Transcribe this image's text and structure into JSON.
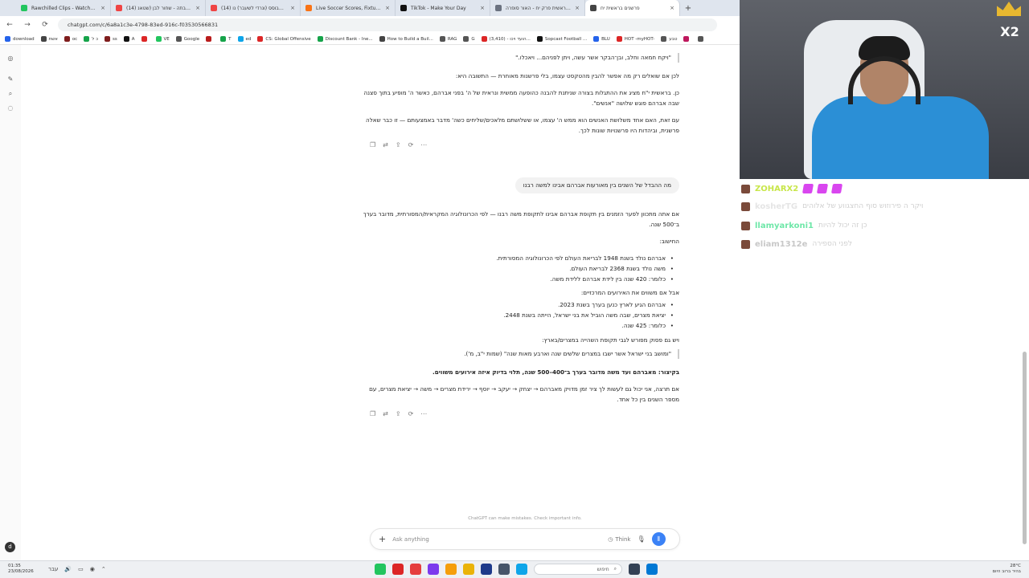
{
  "browser": {
    "tabs": [
      {
        "title": "Rawchilled Clips - Watch Live c...",
        "color": "#22c55e"
      },
      {
        "title": "(14) יאנג טובתה - שחור לבן (שטאנ",
        "color": "#ef4444"
      },
      {
        "title": "(14) שלוםמבוסס (ונרדי לשעבר) נו",
        "color": "#ef4444"
      },
      {
        "title": "Live Soccer Scores, Fixtures, Re...",
        "color": "#f97316"
      },
      {
        "title": "TikTok - Make Your Day",
        "color": "#111111"
      },
      {
        "title": "בראשית פרק יח - האור סופרה...",
        "color": "#6b7280"
      },
      {
        "title": "פרשנים בראשית יח",
        "color": "#444444",
        "active": true
      }
    ],
    "new_tab": "+",
    "close_glyph": "×",
    "url": "chatgpt.com/c/6a8a1c3e-4798-83ed-916c-f03530566831",
    "nav": {
      "back": "←",
      "forward": "→",
      "reload": "⟳",
      "info": "⚙"
    },
    "bookmarks": [
      {
        "label": "download",
        "color": "#2563eb"
      },
      {
        "label": "אשת",
        "color": "#444444"
      },
      {
        "label": "oc",
        "color": "#7f1d1d"
      },
      {
        "label": "כ ל",
        "color": "#16a34a"
      },
      {
        "label": "ss",
        "color": "#7f1d1d"
      },
      {
        "label": "A",
        "color": "#111111"
      },
      {
        "label": "",
        "color": "#dc2626"
      },
      {
        "label": "VE",
        "color": "#22c55e"
      },
      {
        "label": "Google",
        "color": "#555555"
      },
      {
        "label": "",
        "color": "#b91c1c"
      },
      {
        "label": "T",
        "color": "#16a34a"
      },
      {
        "label": "ed",
        "color": "#0ea5e9"
      },
      {
        "label": "CS: Global Offensive",
        "color": "#dc2626"
      },
      {
        "label": "Discount Bank - Ine...",
        "color": "#16a34a"
      },
      {
        "label": "How to Build a Buil...",
        "color": "#444444"
      },
      {
        "label": "RAG",
        "color": "#555555"
      },
      {
        "label": "G",
        "color": "#555555"
      },
      {
        "label": "(3,410) - הועד ויכו...",
        "color": "#dc2626"
      },
      {
        "label": "Sopcast Football ...",
        "color": "#111111"
      },
      {
        "label": "BLU",
        "color": "#2563eb"
      },
      {
        "label": "HOT -myHOT-",
        "color": "#dc2626"
      },
      {
        "label": "טבע",
        "color": "#555555"
      },
      {
        "label": "",
        "color": "#be185d"
      },
      {
        "label": "",
        "color": "#555555"
      }
    ]
  },
  "sidebar": {
    "icons": [
      "chatgpt-logo",
      "new-chat",
      "search",
      "library"
    ],
    "icon_glyphs": [
      "◎",
      "✎",
      "⌕",
      "◌"
    ],
    "avatar_letter": "d"
  },
  "conversation": {
    "a1": {
      "quote": "\"ויקח חמאה וחלב, ובן־הבקר אשר עשה, ויתן לפניהם... ויאכלו.\"",
      "p1": "לכן אם שואלים רק מה אפשר להבין מהטקסט עצמו, בלי פרשנות מאוחרת — התשובה היא:",
      "p2": "כן. בראשית י\"ח מציג את ההתגלות בצורה שניתנת להבנה כהופעה ממשית ונראית של ה' בפני אברהם, כאשר ה' מופיע בתוך סצנה שבה אברהם פוגש שלושה \"אנשים\".",
      "p3": "עם זאת, האם אחד משלושת האנשים הוא ממש ה' עצמו, או ששלושתם מלאכים/שליחים כשה' מדבר באמצעותם — זו כבר שאלה פרשנית, וביהדות היו פרשנויות שונות לכך."
    },
    "user_message": "מה ההבדל של השנים בין מאורעות אברהם אבינו למשה רבנו",
    "a2": {
      "intro": "אם אתה מתכוון לפער הזמנים בין תקופת אברהם אבינו לתקופת משה רבנו — לפי הכרונולוגיה המקראית/המסורתית, מדובר בערך ב־500 שנה.",
      "calc_header": "החישוב:",
      "calc_bullets": [
        "אברהם נולד בשנת 1948 לבריאת העולם לפי הכרונולוגיה המסורתית.",
        "משה נולד בשנת 2368 לבריאת העולם.",
        "כלומר: 420 שנה בין לידת אברהם ללידת משה."
      ],
      "events_header": "אבל אם משווים את האירועים המרכזיים:",
      "events_bullets": [
        "אברהם הגיע לארץ כנען בערך בשנת 2023.",
        "יציאת מצרים, שבה משה הוביל את בני ישראל, הייתה בשנת 2448.",
        "כלומר: 425 שנה."
      ],
      "verse_header": "ויש גם פסוק מפורש לגבי תקופת השהייה במצרים/בארץ:",
      "verse_quote": "\"ומושב בני ישראל אשר ישבו במצרים שלשים שנה וארבע מאות שנה\" (שמות י\"ב, מ').",
      "summary": "בקיצור: מאברהם ועד משה מדובר בערך ב־400–500 שנה, תלוי בדיוק איזה אירועים משווים.",
      "outro": "אם תרצה, אני יכול גם לעשות לך ציר זמן מדויק מאברהם → יצחק → יעקב → יוסף → ירידת מצרים → משה → יציאת מצרים, עם מספר השנים בין כל אחד."
    },
    "action_glyphs": [
      "❐",
      "⇄",
      "⇪",
      "⟳",
      "⋯"
    ]
  },
  "composer": {
    "plus": "+",
    "placeholder": "Ask anything",
    "think_icon": "◷",
    "think_label": "Think",
    "mic_icon": "🎙",
    "voice_icon": "⦀",
    "disclaimer": "ChatGPT can make mistakes. Check important info."
  },
  "stream": {
    "badge_text": "X2",
    "chat": [
      {
        "user": "ZOHARX2",
        "text": "",
        "color": "#c8e64a",
        "emotes": 3
      },
      {
        "user": "kosherTG",
        "text": "ויקר ה פירוזוש סוף החצגווע של אלוהים",
        "color": "#e5e5e5",
        "emotes": 0
      },
      {
        "user": "llamyarkoni1",
        "text": "כן זה יכול להיות",
        "color": "#6ee7a8",
        "emotes": 0
      },
      {
        "user": "eliam1312e",
        "text": "לפני הספירה",
        "color": "#c8c8c8",
        "emotes": 0
      }
    ]
  },
  "taskbar": {
    "time": "01:35",
    "date": "23/08/2026",
    "lang": "ENG",
    "weather_temp": "28°C",
    "weather_text": "בהיר ברוב היום",
    "search_label": "חיפוש",
    "search_icon": "⌕",
    "sys_icons": [
      "עבר",
      "🔊",
      "▭",
      "◉",
      "⌃"
    ],
    "apps": [
      "#22c55e",
      "#dc2626",
      "#e53e3e",
      "#7c3aed",
      "#f59e0b",
      "#eab308",
      "#1e3a8a",
      "#475569",
      "#0ea5e9",
      "#334155"
    ],
    "start_color": "#0078d4"
  }
}
